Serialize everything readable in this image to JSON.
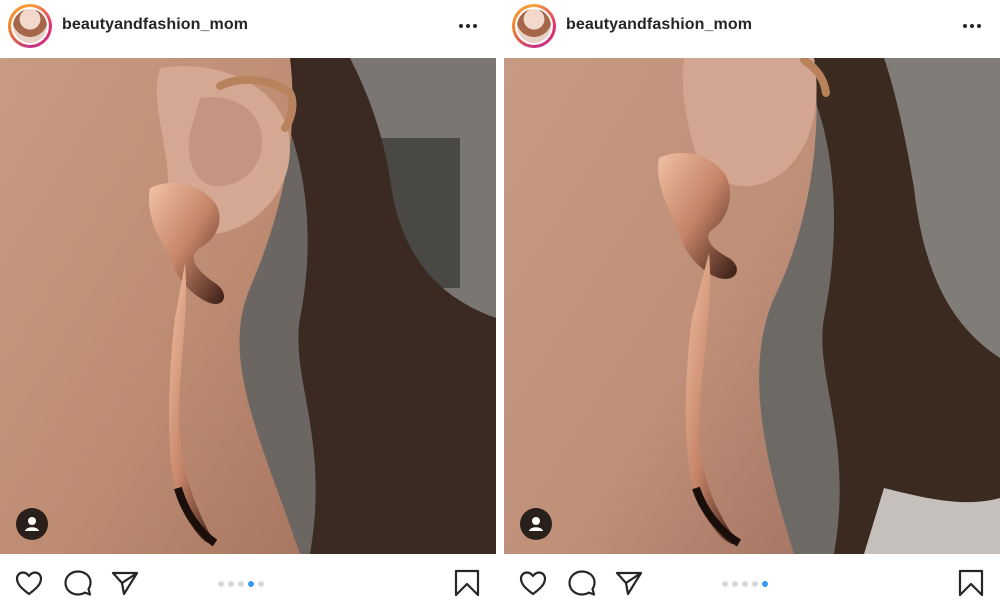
{
  "accent_color": "#3897f0",
  "posts": [
    {
      "username": "beautyandfashion_mom",
      "carousel": {
        "count": 5,
        "active_index": 3
      },
      "icons": {
        "avatar": "profile-avatar",
        "more": "more-options-icon",
        "tag": "user-tag-icon",
        "like": "heart-icon",
        "comment": "comment-icon",
        "share": "paper-plane-icon",
        "save": "bookmark-icon"
      }
    },
    {
      "username": "beautyandfashion_mom",
      "carousel": {
        "count": 5,
        "active_index": 4
      },
      "icons": {
        "avatar": "profile-avatar",
        "more": "more-options-icon",
        "tag": "user-tag-icon",
        "like": "heart-icon",
        "comment": "comment-icon",
        "share": "paper-plane-icon",
        "save": "bookmark-icon"
      }
    }
  ]
}
